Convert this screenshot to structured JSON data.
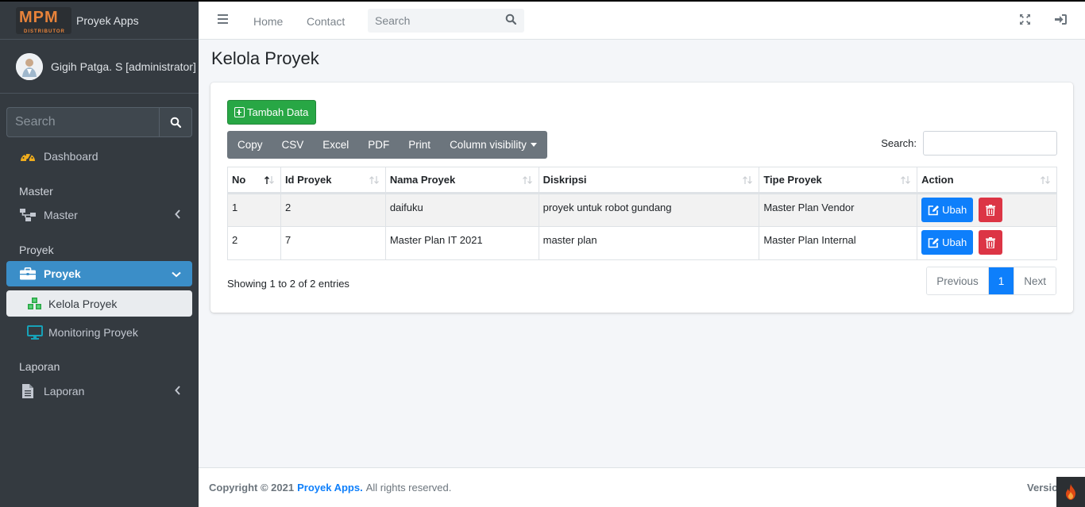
{
  "brand": {
    "logo_text": "MPM",
    "logo_sub": "DISTRIBUTOR",
    "app_name": "Proyek Apps"
  },
  "user": {
    "name": "Gigih Patga. S [administrator]"
  },
  "sidebar": {
    "search_placeholder": "Search",
    "dashboard": "Dashboard",
    "header_master": "Master",
    "master": "Master",
    "header_proyek": "Proyek",
    "proyek": "Proyek",
    "kelola_proyek": "Kelola Proyek",
    "monitoring_proyek": "Monitoring Proyek",
    "header_laporan": "Laporan",
    "laporan": "Laporan"
  },
  "topbar": {
    "home": "Home",
    "contact": "Contact",
    "search_placeholder": "Search"
  },
  "page": {
    "title": "Kelola Proyek"
  },
  "toolbar": {
    "add": "Tambah Data",
    "buttons": [
      "Copy",
      "CSV",
      "Excel",
      "PDF",
      "Print",
      "Column visibility"
    ],
    "search_label": "Search:"
  },
  "table": {
    "columns": [
      "No",
      "Id Proyek",
      "Nama Proyek",
      "Diskripsi",
      "Tipe Proyek",
      "Action"
    ],
    "rows": [
      [
        "1",
        "2",
        "daifuku",
        "proyek untuk robot gundang",
        "Master Plan Vendor"
      ],
      [
        "2",
        "7",
        "Master Plan IT 2021",
        "master plan",
        "Master Plan Internal"
      ]
    ],
    "edit_label": "Ubah",
    "info": "Showing 1 to 2 of 2 entries"
  },
  "pagination": {
    "previous": "Previous",
    "current": "1",
    "next": "Next"
  },
  "footer": {
    "copyright": "Copyright © 2021",
    "brand": "Proyek Apps.",
    "rights": "All rights reserved.",
    "version": "Version"
  },
  "colors": {
    "sidebar": "#343a40",
    "active": "#3b8ec8",
    "success": "#28a745",
    "primary": "#0e7ffb",
    "danger": "#dc3545"
  }
}
